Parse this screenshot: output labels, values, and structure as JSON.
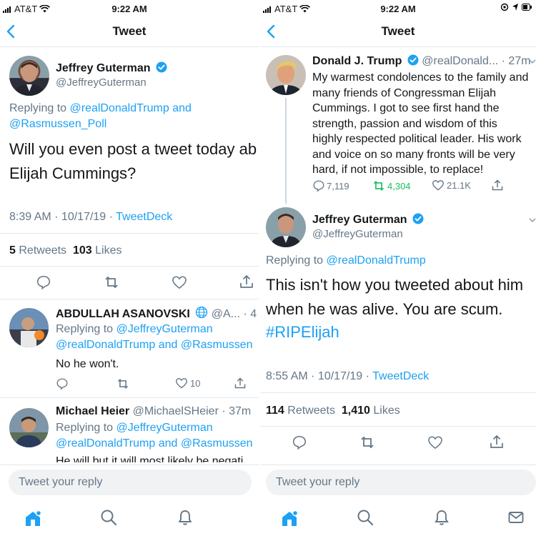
{
  "left": {
    "status": {
      "carrier": "AT&T",
      "time": "9:22 AM"
    },
    "nav": {
      "title": "Tweet"
    },
    "main_tweet": {
      "name": "Jeffrey Guterman",
      "handle": "@JeffreyGuterman",
      "replying_prefix": "Replying to",
      "replying_to_1": "@realDonaldTrump",
      "replying_and": "and",
      "replying_to_2": "@Rasmussen_Poll",
      "text_line1": "Will you even post a tweet today ab",
      "text_line2": "Elijah Cummings?",
      "timestamp": "8:39 AM · 10/17/19 · ",
      "source": "TweetDeck",
      "retweets_count": "5",
      "retweets_label": "Retweets",
      "likes_count": "103",
      "likes_label": "Likes"
    },
    "replies": [
      {
        "name": "ABDULLAH ASANOVSKI",
        "handle_time": "@A... · 4",
        "replying_prefix": "Replying to",
        "replying_to_1": "@JeffreyGuterman",
        "replying_line2": "@realDonaldTrump and @Rasmussen",
        "text": "No he won't.",
        "like_count": "10"
      },
      {
        "name": "Michael Heier",
        "handle_time": "@MichaelSHeier · 37m",
        "replying_prefix": "Replying to",
        "replying_to_1": "@JeffreyGuterman",
        "replying_line2": "@realDonaldTrump and @Rasmussen",
        "text": "He will but it will most likely be negati"
      }
    ],
    "reply_placeholder": "Tweet your reply"
  },
  "right": {
    "status": {
      "carrier": "AT&T",
      "time": "9:22 AM"
    },
    "nav": {
      "title": "Tweet"
    },
    "parent_tweet": {
      "name": "Donald J. Trump",
      "handle_time": "@realDonald... · 27m",
      "lines": [
        "My warmest condolences to the family and",
        "many friends of Congressman Elijah",
        "Cummings. I got to see first hand the",
        "strength, passion and wisdom of this",
        "highly respected political leader. His work",
        "and voice on so many fronts will be very",
        "hard, if not impossible, to replace!"
      ],
      "reply_count": "7,119",
      "retweet_count": "4,304",
      "like_count": "21.1K"
    },
    "main_tweet": {
      "name": "Jeffrey Guterman",
      "handle": "@JeffreyGuterman",
      "replying_prefix": "Replying to",
      "replying_to_1": "@realDonaldTrump",
      "text_line1": "This isn't how you tweeted about him",
      "text_line2": "when he was alive. You are scum.",
      "hashtag": "#RIPElijah",
      "timestamp": "8:55 AM · 10/17/19 · ",
      "source": "TweetDeck",
      "retweets_count": "114",
      "retweets_label": "Retweets",
      "likes_count": "1,410",
      "likes_label": "Likes"
    },
    "reply_placeholder": "Tweet your reply"
  },
  "colors": {
    "twitter_blue": "#1da1f2",
    "retweet_green": "#17bf63",
    "grey": "#657786"
  }
}
